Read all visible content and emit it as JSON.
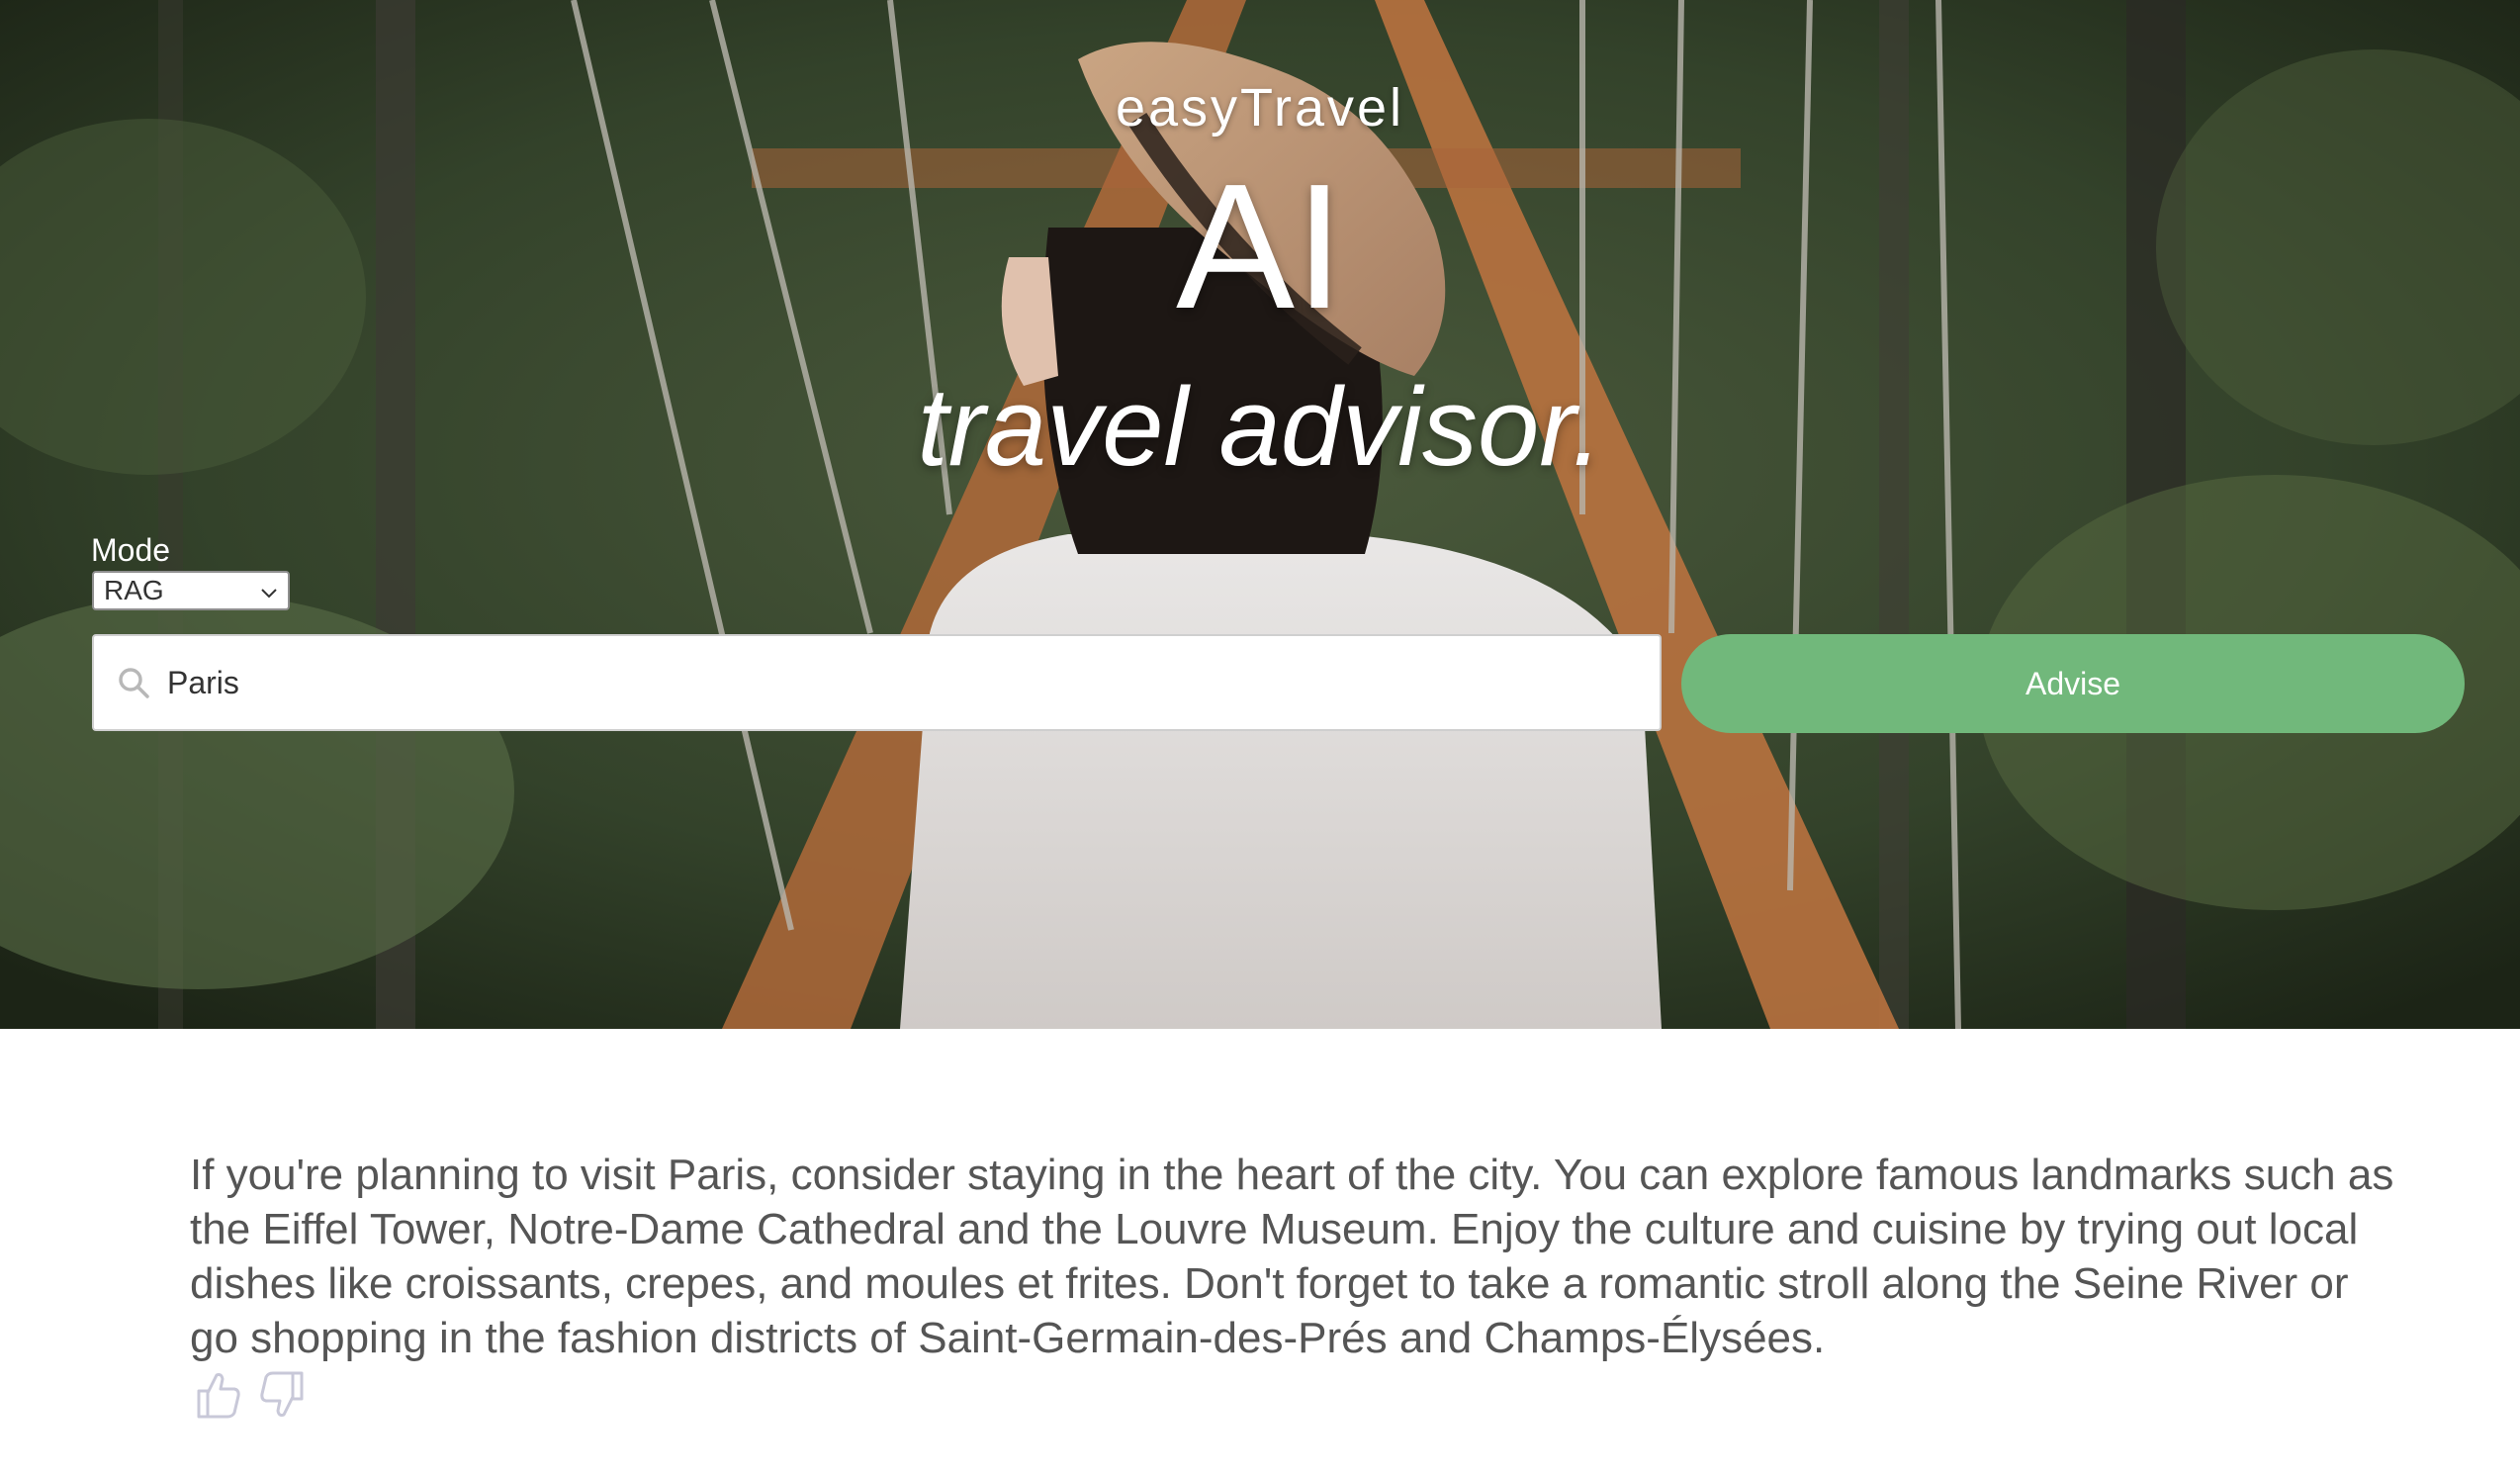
{
  "hero": {
    "brand": "easyTravel",
    "headline": "AI",
    "subheadline": "travel advisor."
  },
  "form": {
    "mode_label": "Mode",
    "mode_value": "RAG",
    "search_value": "Paris",
    "advise_label": "Advise"
  },
  "result": {
    "answer": "If you're planning to visit Paris, consider staying in the heart of the city. You can explore famous landmarks such as the Eiffel Tower, Notre-Dame Cathedral and the Louvre Museum. Enjoy the culture and cuisine by trying out local dishes like croissants, crepes, and moules et frites. Don't forget to take a romantic stroll along the Seine River or go shopping in the fashion districts of Saint-Germain-des-Prés and Champs-Élysées."
  },
  "icons": {
    "search": "search-icon",
    "dropdown": "chevron-down-icon",
    "like": "thumbs-up-icon",
    "dislike": "thumbs-down-icon"
  },
  "colors": {
    "accent": "#71b87b",
    "text": "#555555",
    "feedback_icon": "#c8c8d8"
  }
}
